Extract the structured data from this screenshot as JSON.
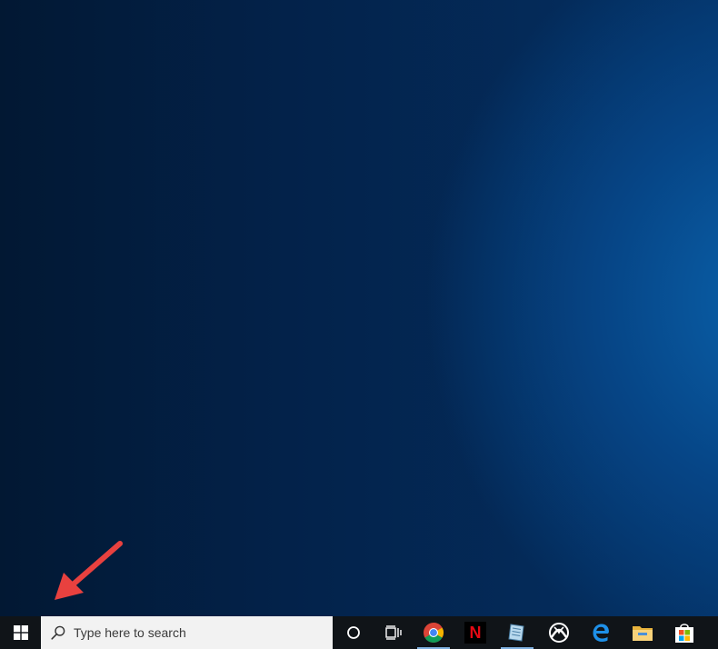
{
  "desktop": {
    "background_color_dark": "#021833",
    "background_color_light": "#0a63ad"
  },
  "annotation": {
    "arrow_color": "#e8413f"
  },
  "taskbar": {
    "background_color": "#101418",
    "start": {
      "icon": "windows-logo-icon"
    },
    "search": {
      "placeholder": "Type here to search",
      "icon": "search-icon"
    },
    "buttons": [
      {
        "name": "cortana",
        "icon": "cortana-icon",
        "active": false
      },
      {
        "name": "task-view",
        "icon": "task-view-icon",
        "active": false
      },
      {
        "name": "chrome",
        "icon": "chrome-icon",
        "active": true
      },
      {
        "name": "netflix",
        "icon": "netflix-icon",
        "active": false,
        "glyph": "N"
      },
      {
        "name": "app",
        "icon": "notebook-icon",
        "active": true
      },
      {
        "name": "xbox",
        "icon": "xbox-icon",
        "active": false
      },
      {
        "name": "edge",
        "icon": "edge-icon",
        "active": false
      },
      {
        "name": "file-explorer",
        "icon": "folder-icon",
        "active": false
      },
      {
        "name": "store",
        "icon": "store-icon",
        "active": false
      }
    ]
  }
}
